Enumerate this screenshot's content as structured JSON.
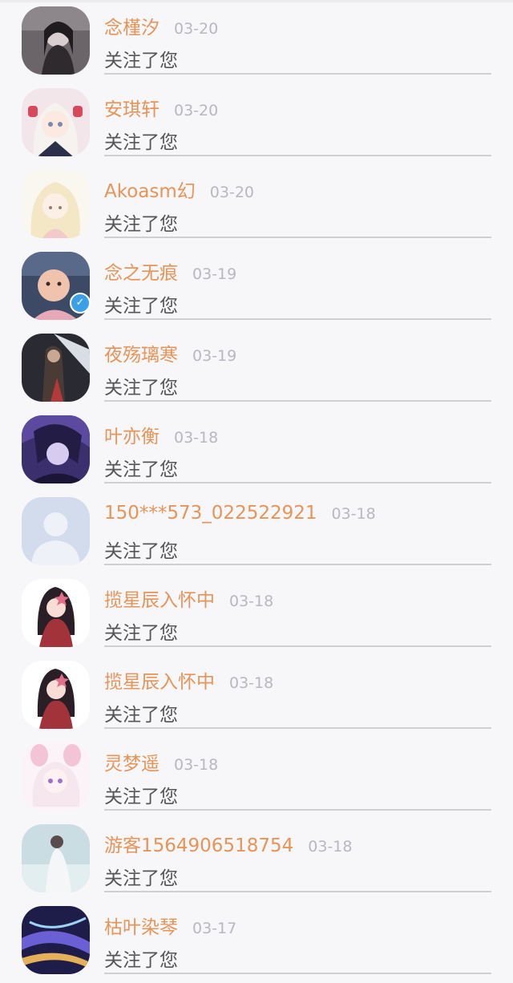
{
  "notifications": [
    {
      "name": "念槿汐",
      "date": "03-20",
      "action": "关注了您",
      "avatar": "girl-photo-dark",
      "verified": false
    },
    {
      "name": "安琪轩",
      "date": "03-20",
      "action": "关注了您",
      "avatar": "anime-girl-white-hair",
      "verified": false
    },
    {
      "name": "Akoasm幻",
      "date": "03-20",
      "action": "关注了您",
      "avatar": "anime-girl-blonde",
      "verified": false
    },
    {
      "name": "念之无痕",
      "date": "03-19",
      "action": "关注了您",
      "avatar": "baby-photo",
      "verified": true
    },
    {
      "name": "夜殇璃寒",
      "date": "03-19",
      "action": "关注了您",
      "avatar": "anime-warrior-dark",
      "verified": false
    },
    {
      "name": "叶亦衡",
      "date": "03-18",
      "action": "关注了您",
      "avatar": "anime-boy-purple",
      "verified": false
    },
    {
      "name": "150***573_022522921",
      "date": "03-18",
      "action": "关注了您",
      "avatar": "default-person",
      "verified": false
    },
    {
      "name": "揽星辰入怀中",
      "date": "03-18",
      "action": "关注了您",
      "avatar": "anime-girl-red-scarf",
      "verified": false
    },
    {
      "name": "揽星辰入怀中",
      "date": "03-18",
      "action": "关注了您",
      "avatar": "anime-girl-red-scarf",
      "verified": false
    },
    {
      "name": "灵梦遥",
      "date": "03-18",
      "action": "关注了您",
      "avatar": "anime-girl-bunny-ears",
      "verified": false
    },
    {
      "name": "游客1564906518754",
      "date": "03-18",
      "action": "关注了您",
      "avatar": "girl-white-dress",
      "verified": false
    },
    {
      "name": "枯叶染琴",
      "date": "03-17",
      "action": "关注了您",
      "avatar": "city-night-lights",
      "verified": false
    }
  ],
  "colors": {
    "name": "#e69457",
    "date": "#b9b7bf",
    "action": "#555555",
    "background": "#f7f6f9",
    "verified_badge": "#3aa0e8"
  }
}
